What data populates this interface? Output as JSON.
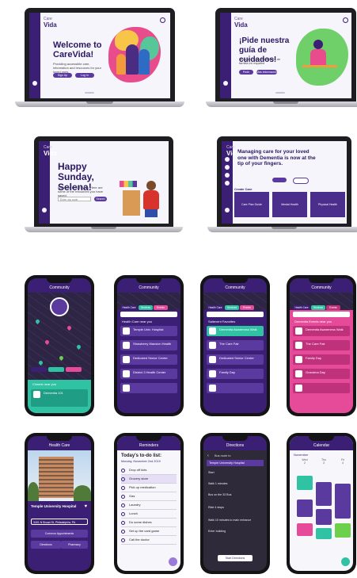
{
  "laptops": [
    {
      "logo": "Vida",
      "logo_sub": "Care",
      "heading": "Welcome to CareVida!",
      "body": "Providing accessible care, information and resources for your loved ones",
      "btn1": "Sign Up",
      "btn2": "Log In"
    },
    {
      "logo": "Vida",
      "logo_sub": "Care",
      "heading": "¡Pide nuestra guía de cuidados!",
      "body": "Recursos para cuidadores de familia en español",
      "btn1": "Pedir",
      "btn2": "Más información"
    },
    {
      "logo": "Vida",
      "logo_sub": "Care",
      "heading": "Happy Sunday, Selena!",
      "body": "Welcome to CareVida. Here are some of the resources you have saved.",
      "input": "Enter zip code",
      "btn1": "Search"
    },
    {
      "logo": "Vida",
      "logo_sub": "Care",
      "heading": "Managing care for your loved one with Dementia is now at the tip of your fingers.",
      "section": "Create Care",
      "cards": [
        "Care Plan Guide",
        "Mental Health",
        "Physical Health"
      ]
    }
  ],
  "phones_row1": [
    {
      "title": "Community",
      "sheet_title": "Closest near you",
      "sheet_item": "Dementia 101"
    },
    {
      "title": "Community",
      "tabs": [
        "Health Care",
        "Services",
        "Events"
      ],
      "list_header": "Health Care near you",
      "items": [
        "Temple Univ. Hospital",
        "Strawberry Mansion Health",
        "Dedicated Senior Center",
        "District 3 Health Center"
      ]
    },
    {
      "title": "Community",
      "tabs": [
        "Health Care",
        "Services",
        "Events"
      ],
      "list_header": "Saltevent Favorites",
      "items": [
        "Dementia Awareness Walk",
        "The Care Fair",
        "Dedicated Senior Center",
        "Family Day"
      ]
    },
    {
      "title": "Community",
      "tabs": [
        "Health Care",
        "Services",
        "Events"
      ],
      "list_header": "Dementia Events near you",
      "items": [
        "Dementia Awareness Walk",
        "The Care Fair",
        "Family Day",
        "Grandma Day"
      ]
    }
  ],
  "phones_row2": [
    {
      "title": "Health Care",
      "place": "Temple University Hospital",
      "address": "3401 N Broad St, Philadelphia, PA",
      "btn1": "Common Appointments",
      "btn2": "Directions",
      "btn3": "Pharmacy"
    },
    {
      "title": "Reminders",
      "heading": "Today's to-do list:",
      "date": "Monday, November 2nd 2019",
      "todos": [
        "Drop off kids",
        "Grocery store",
        "Pick up medication",
        "Gas",
        "Laundry",
        "Lunch",
        "Do some dishes",
        "Set up the card game",
        "Call the doctor"
      ]
    },
    {
      "title": "Directions",
      "subtitle": "Bus route to",
      "dest": "Temple University Hospital",
      "steps": [
        "Start",
        "Walk 1 minutes",
        "Bus on the 33 Bus",
        "Ride 4 stops",
        "Walk 10 minutes to main entrance",
        "Enter building"
      ],
      "btn": "Start Directions"
    },
    {
      "title": "Calendar",
      "month": "November",
      "days": [
        "Wed",
        "Thu",
        "Fri"
      ],
      "day_nums": [
        "2",
        "3",
        "4"
      ]
    }
  ],
  "colors": {
    "purple": "#3b1f74",
    "violet": "#5b3aa0",
    "pink": "#e64b9a",
    "teal": "#2fc3a4",
    "green": "#6dd04a"
  }
}
